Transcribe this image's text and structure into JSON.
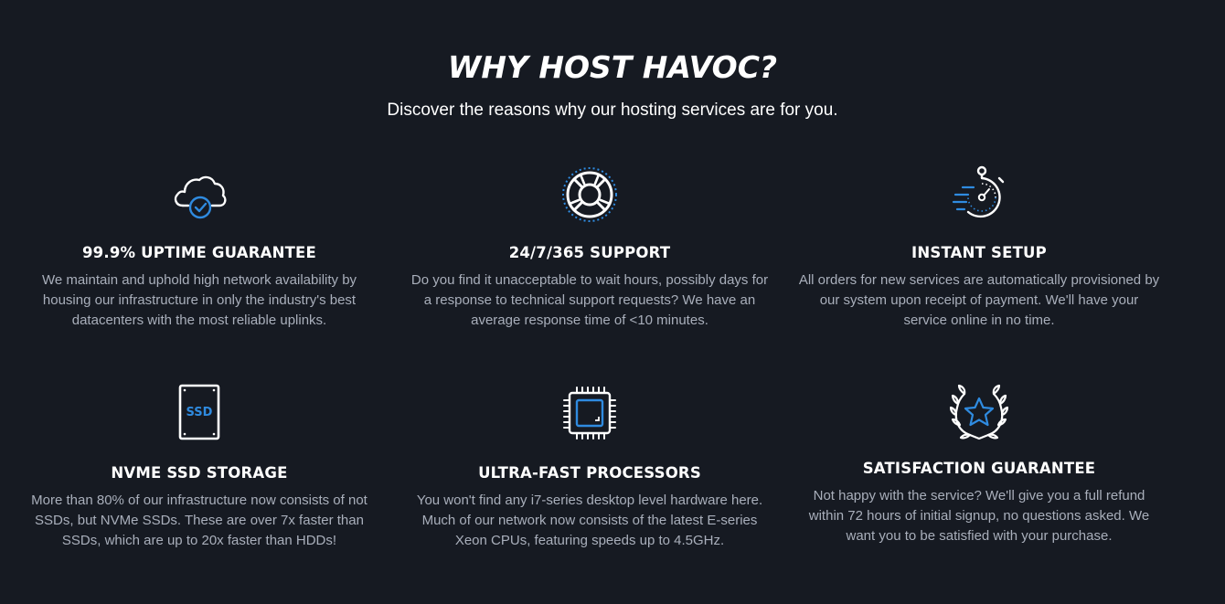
{
  "header": {
    "title": "WHY HOST HAVOC?",
    "subtitle": "Discover the reasons why our hosting services are for you."
  },
  "colors": {
    "background": "#161a22",
    "accent": "#2f8be0",
    "text": "#ffffff",
    "muted": "#a9afbb"
  },
  "features": [
    {
      "icon": "cloud-check-icon",
      "title": "99.9% UPTIME GUARANTEE",
      "description": "We maintain and uphold high network availability by housing our infrastructure in only the industry's best datacenters with the most reliable uplinks."
    },
    {
      "icon": "lifebuoy-icon",
      "title": "24/7/365 SUPPORT",
      "description": "Do you find it unacceptable to wait hours, possibly days for a response to technical support requests? We have an average response time of <10 minutes."
    },
    {
      "icon": "stopwatch-icon",
      "title": "INSTANT SETUP",
      "description": "All orders for new services are automatically provisioned by our system upon receipt of payment. We'll have your service online in no time."
    },
    {
      "icon": "ssd-icon",
      "icon_label": "SSD",
      "title": "NVME SSD STORAGE",
      "description": "More than 80% of our infrastructure now consists of not SSDs, but NVMe SSDs. These are over 7x faster than SSDs, which are up to 20x faster than HDDs!"
    },
    {
      "icon": "processor-icon",
      "title": "ULTRA-FAST PROCESSORS",
      "description": "You won't find any i7-series desktop level hardware here. Much of our network now consists of the latest E-series Xeon CPUs, featuring speeds up to 4.5GHz."
    },
    {
      "icon": "laurel-star-icon",
      "title": "SATISFACTION GUARANTEE",
      "description": "Not happy with the service? We'll give you a full refund within 72 hours of initial signup, no questions asked. We want you to be satisfied with your purchase."
    }
  ]
}
